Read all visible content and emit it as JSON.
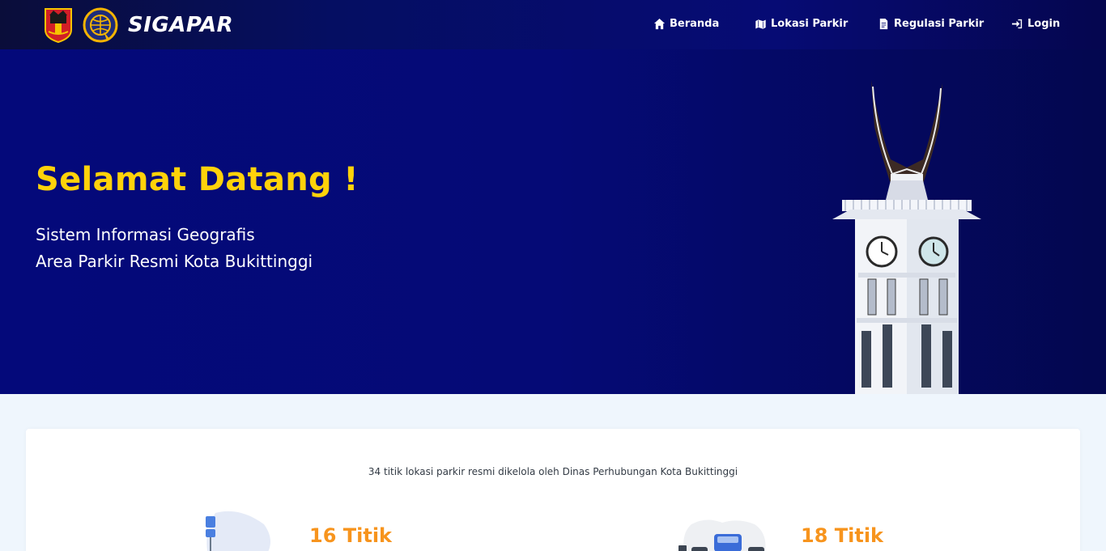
{
  "brand": {
    "name": "SIGAPAR"
  },
  "nav": {
    "items": [
      {
        "label": "Beranda",
        "icon": "home-icon"
      },
      {
        "label": "Lokasi Parkir",
        "icon": "map-icon"
      },
      {
        "label": "Regulasi Parkir",
        "icon": "file-icon"
      },
      {
        "label": "Login",
        "icon": "sign-in-icon"
      }
    ]
  },
  "hero": {
    "title": "Selamat Datang !",
    "subtitle_line1": "Sistem Informasi Geografis",
    "subtitle_line2": "Area Parkir Resmi Kota Bukittinggi"
  },
  "summary": {
    "description": "34 titik lokasi parkir resmi dikelola oleh Dinas Perhubungan Kota Bukittinggi",
    "stat1": "16 Titik",
    "stat2": "18 Titik"
  },
  "colors": {
    "navbar": "#060b74",
    "hero": "#04097a",
    "title_yellow": "#ffd20a",
    "stat_orange": "#f7941d",
    "page_bg": "#eff6fd"
  }
}
